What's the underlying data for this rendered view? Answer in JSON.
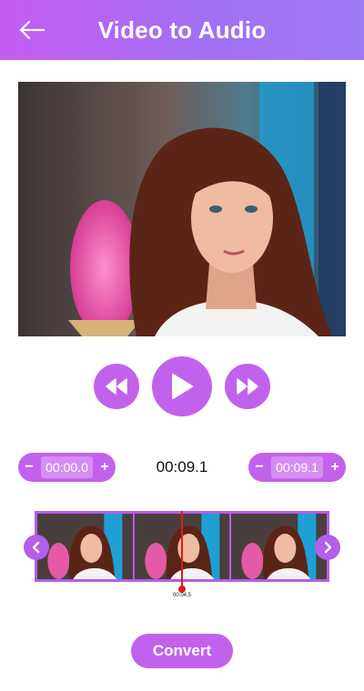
{
  "header": {
    "title": "Video to Audio",
    "back_icon": "arrow-left-icon",
    "gradient": [
      "#c65cf2",
      "#9d7af6"
    ]
  },
  "player": {
    "controls": [
      {
        "name": "rewind",
        "icon": "rewind-icon"
      },
      {
        "name": "play",
        "icon": "play-icon"
      },
      {
        "name": "forward",
        "icon": "fast-forward-icon"
      }
    ]
  },
  "trim": {
    "start": {
      "minus": "−",
      "value": "00:00.0",
      "plus": "+"
    },
    "duration": "00:09.1",
    "end": {
      "minus": "−",
      "value": "00:09.1",
      "plus": "+"
    }
  },
  "timeline": {
    "frame_count": 3,
    "playhead_time": "00:04.5",
    "prev_icon": "chevron-left-icon",
    "next_icon": "chevron-right-icon"
  },
  "convert_label": "Convert",
  "colors": {
    "accent": "#c262ec",
    "frame_border": "#b45ee9",
    "playhead": "#e01818"
  }
}
